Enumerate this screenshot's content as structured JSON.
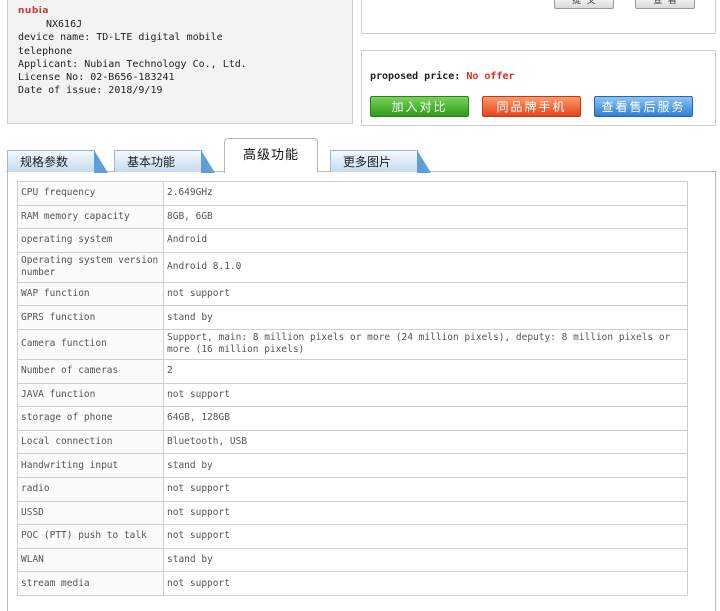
{
  "device": {
    "brand": "nubia",
    "model": "NX616J",
    "lines": [
      "device name: TD-LTE digital mobile",
      "telephone",
      "Applicant: Nubian Technology Co., Ltd.",
      "License No: 02-B656-183241",
      "Date of issue: 2018/9/19"
    ]
  },
  "top_buttons": [
    "提 交",
    "查 看"
  ],
  "price": {
    "label": "proposed price:",
    "value": "No offer"
  },
  "actions": {
    "compare": "加入对比",
    "same_brand": "同品牌手机",
    "after_sales": "查看售后服务"
  },
  "tabs": {
    "specs": "规格参数",
    "basic": "基本功能",
    "advanced": "高级功能",
    "images": "更多图片"
  },
  "colors": {
    "price": "#e12b1f",
    "green_btn": "#2f9b19",
    "orange_btn": "#e2461b",
    "blue_btn": "#2f7fd3",
    "tab": "#c5daf0"
  },
  "spec_rows": [
    {
      "key": "CPU frequency",
      "value": "2.649GHz"
    },
    {
      "key": "RAM memory capacity",
      "value": "8GB, 6GB"
    },
    {
      "key": "operating system",
      "value": "Android"
    },
    {
      "key": "Operating system version number",
      "value": "Android 8.1.0"
    },
    {
      "key": "WAP function",
      "value": "not support"
    },
    {
      "key": "GPRS function",
      "value": "stand by"
    },
    {
      "key": "Camera function",
      "value": "Support, main: 8 million pixels or more (24 million pixels), deputy: 8 million pixels or more (16 million pixels)"
    },
    {
      "key": "Number of cameras",
      "value": "2"
    },
    {
      "key": "JAVA function",
      "value": "not support"
    },
    {
      "key": "storage of phone",
      "value": "64GB, 128GB"
    },
    {
      "key": "Local connection",
      "value": "Bluetooth, USB"
    },
    {
      "key": "Handwriting input",
      "value": "stand by"
    },
    {
      "key": "radio",
      "value": "not support"
    },
    {
      "key": "USSD",
      "value": "not support"
    },
    {
      "key": "POC (PTT) push to talk",
      "value": "not support"
    },
    {
      "key": "WLAN",
      "value": "stand by"
    },
    {
      "key": "stream media",
      "value": "not support"
    }
  ]
}
